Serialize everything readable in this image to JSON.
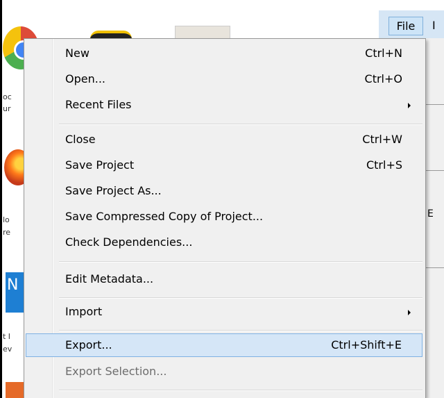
{
  "desktop": {
    "icon_texts": [
      "oc",
      "ur",
      "lo",
      "re",
      "t I",
      "ev"
    ]
  },
  "app": {
    "menubar": {
      "file_label": "File",
      "next_label": "I"
    },
    "fragment_char": "E"
  },
  "file_menu": {
    "items": [
      {
        "label": "New",
        "shortcut": "Ctrl+N"
      },
      {
        "label": "Open...",
        "shortcut": "Ctrl+O"
      },
      {
        "label": "Recent Files",
        "shortcut": ""
      },
      {
        "label": "Close",
        "shortcut": "Ctrl+W"
      },
      {
        "label": "Save Project",
        "shortcut": "Ctrl+S"
      },
      {
        "label": "Save Project As...",
        "shortcut": ""
      },
      {
        "label": "Save Compressed Copy of Project...",
        "shortcut": ""
      },
      {
        "label": "Check Dependencies...",
        "shortcut": ""
      },
      {
        "label": "Edit Metadata...",
        "shortcut": ""
      },
      {
        "label": "Import",
        "shortcut": ""
      },
      {
        "label": "Export...",
        "shortcut": "Ctrl+Shift+E"
      },
      {
        "label": "Export Selection...",
        "shortcut": ""
      }
    ],
    "hovered_item": "Export...",
    "disabled_items": [
      "Export Selection..."
    ],
    "submenu_items": [
      "Recent Files",
      "Import"
    ]
  },
  "colors": {
    "menu_bg": "#f0f0f0",
    "hover_bg": "#d5e6f7",
    "hover_border": "#7fb1e3",
    "disabled_text": "#6d6d6d",
    "menubar_active": "#cde4f7"
  }
}
